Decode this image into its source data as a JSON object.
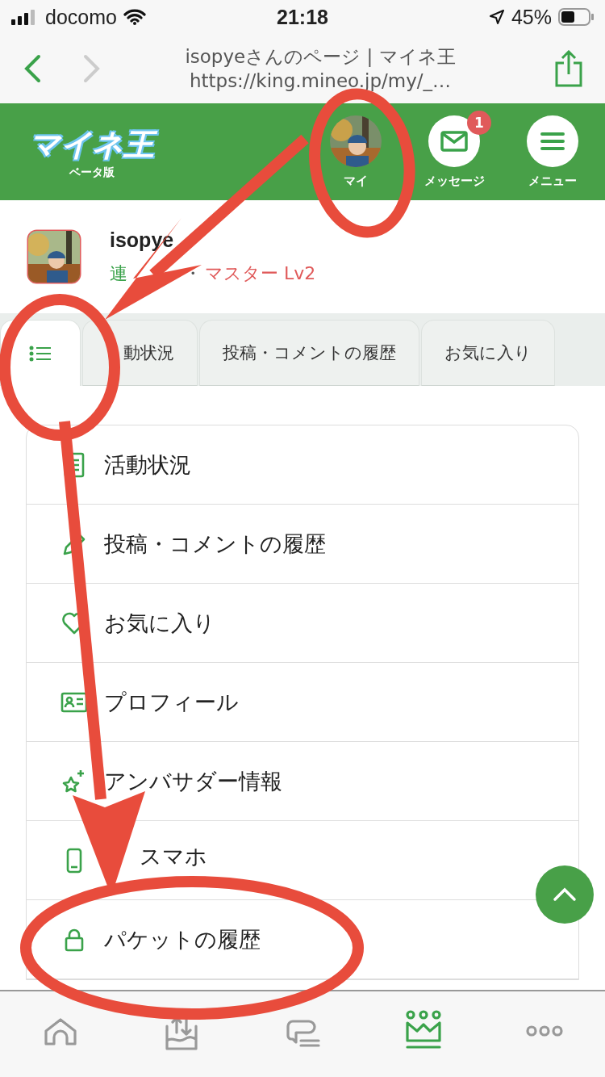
{
  "status_bar": {
    "carrier": "docomo",
    "time": "21:18",
    "battery": "45%"
  },
  "browser": {
    "title": "isopyeさんのページ | マイネ王",
    "url": "https://king.mineo.jp/my/_…"
  },
  "header": {
    "logo": "マイネ王",
    "logo_sub": "ベータ版",
    "nav": [
      {
        "label": "マイ"
      },
      {
        "label": "メッセージ",
        "badge": "1"
      },
      {
        "label": "メニュー"
      }
    ]
  },
  "profile": {
    "name": "isopye",
    "status": "連",
    "separator": "・",
    "rank": "マスター Lv2"
  },
  "tabs": [
    {
      "kind": "icon",
      "selected": true
    },
    {
      "kind": "text",
      "label": "動状況",
      "selected": false
    },
    {
      "kind": "text",
      "label": "投稿・コメントの履歴",
      "selected": false
    },
    {
      "kind": "text",
      "label": "お気に入り",
      "selected": false
    }
  ],
  "menu_items": [
    "活動状況",
    "投稿・コメントの履歴",
    "お気に入り",
    "プロフィール",
    "アンバサダー情報",
    "スマホ",
    "パケットの履歴"
  ],
  "bottom_nav": [
    {
      "selected": false
    },
    {
      "selected": false
    },
    {
      "selected": false
    },
    {
      "selected": true
    },
    {
      "selected": false
    }
  ]
}
